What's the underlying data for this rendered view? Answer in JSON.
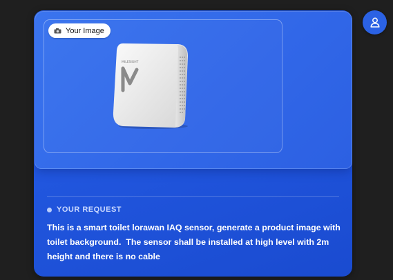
{
  "image_card": {
    "badge_label": "Your Image",
    "badge_icon": "camera-icon",
    "product_brand_text": "MILESIGHT"
  },
  "request": {
    "label": "YOUR REQUEST",
    "text": "This is a smart toilet lorawan IAQ sensor, generate a product image with toilet background.  The sensor shall be installed at high level with 2m height and there is no cable"
  },
  "avatar": {
    "icon": "user-icon"
  },
  "colors": {
    "background": "#1f1f1f",
    "card": "#2156de",
    "accent": "#2b62e4"
  }
}
